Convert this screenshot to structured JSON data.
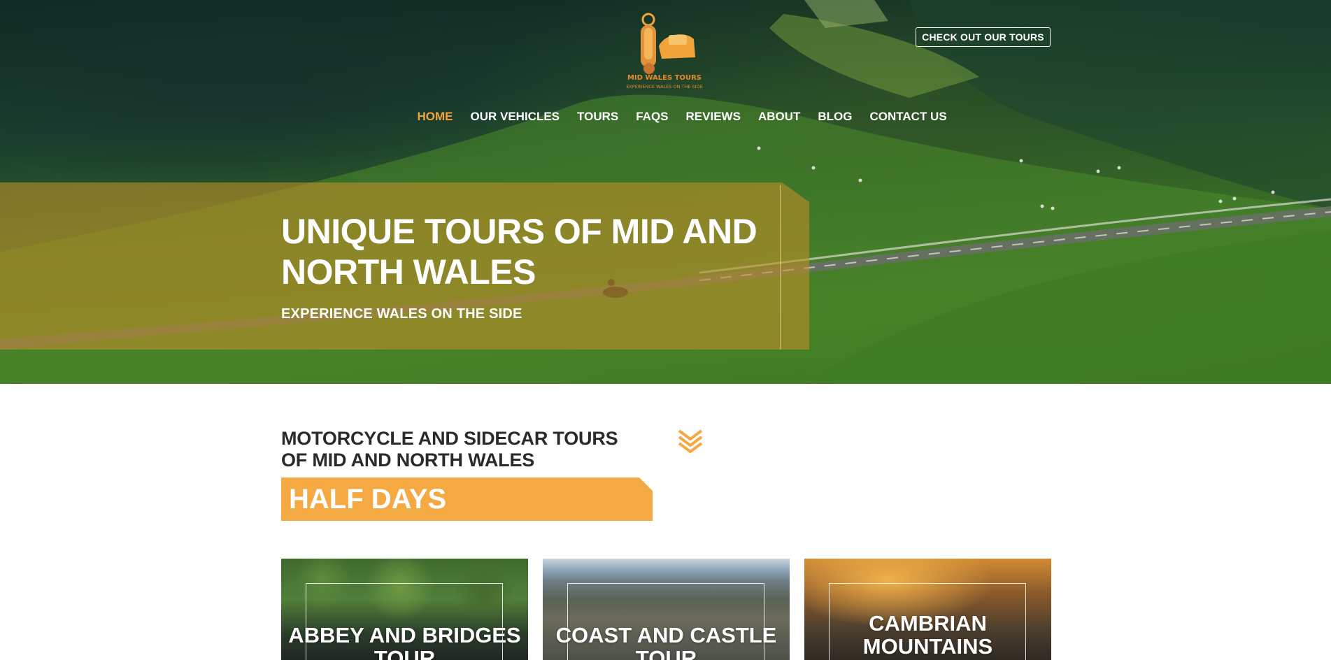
{
  "brand": {
    "logo_text": "MID WALES TOURS",
    "logo_tagline": "EXPERIENCE WALES ON THE SIDE"
  },
  "header": {
    "cta_label": "CHECK OUT OUR TOURS"
  },
  "nav": {
    "items": [
      {
        "label": "HOME",
        "active": true
      },
      {
        "label": "OUR VEHICLES",
        "active": false
      },
      {
        "label": "TOURS",
        "active": false
      },
      {
        "label": "FAQS",
        "active": false
      },
      {
        "label": "REVIEWS",
        "active": false
      },
      {
        "label": "ABOUT",
        "active": false
      },
      {
        "label": "BLOG",
        "active": false
      },
      {
        "label": "CONTACT US",
        "active": false
      }
    ]
  },
  "hero": {
    "title": "UNIQUE TOURS OF MID AND NORTH WALES",
    "subtitle": "EXPERIENCE WALES ON THE SIDE"
  },
  "section": {
    "heading": "MOTORCYCLE AND SIDECAR TOURS OF MID AND NORTH WALES",
    "category_label": "HALF DAYS",
    "scroll_icon": "chevron-double-down-icon"
  },
  "tours": [
    {
      "title": "ABBEY AND BRIDGES TOUR"
    },
    {
      "title": "COAST AND CASTLE TOUR"
    },
    {
      "title": "CAMBRIAN MOUNTAINS"
    }
  ],
  "colors": {
    "accent": "#f4a942",
    "nav_active": "#f2a43a",
    "heading_text": "#2b2a2a",
    "banner_overlay": "#b98c28"
  }
}
